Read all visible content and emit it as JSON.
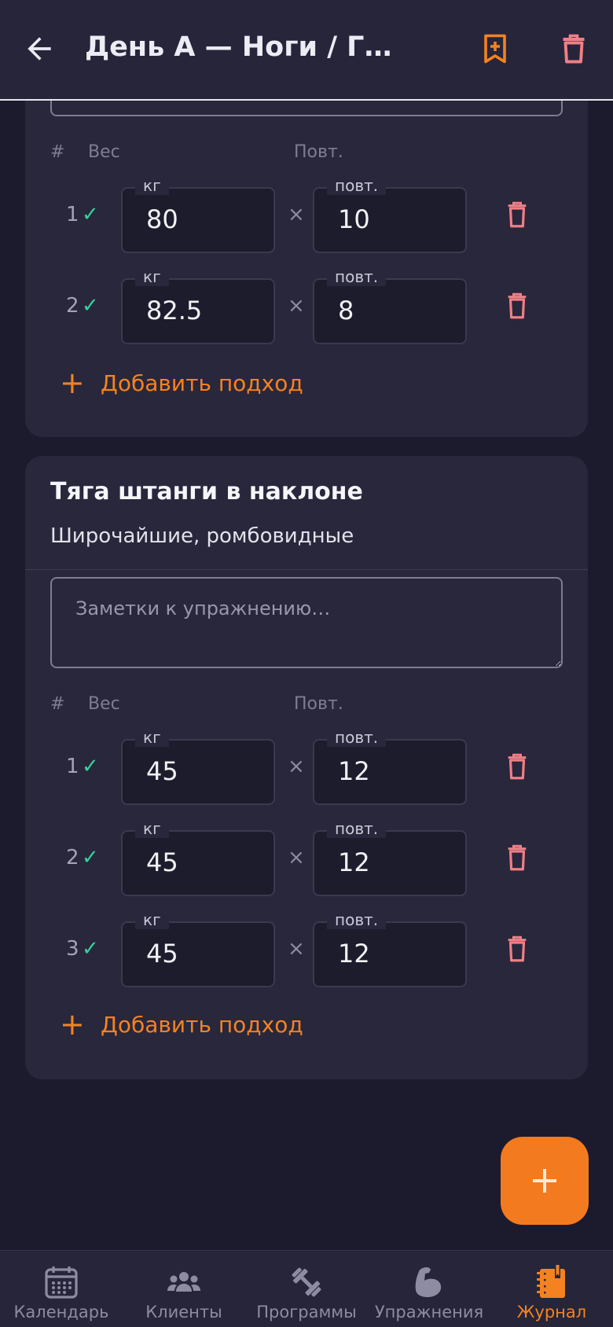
{
  "header": {
    "title": "День А — Ноги / Г…"
  },
  "labels": {
    "num_col": "#",
    "weight_col": "Вес",
    "reps_col": "Повт.",
    "kg": "кг",
    "reps": "повт.",
    "times": "×",
    "add_set": "Добавить подход",
    "plus": "+",
    "check": "✓"
  },
  "exercise1": {
    "sets": [
      {
        "num": "1",
        "weight": "80",
        "reps": "10"
      },
      {
        "num": "2",
        "weight": "82.5",
        "reps": "8"
      }
    ]
  },
  "exercise2": {
    "name": "Тяга штанги в наклоне",
    "muscles": "Широчайшие, ромбовидные",
    "notes_placeholder": "Заметки к упражнению…",
    "sets": [
      {
        "num": "1",
        "weight": "45",
        "reps": "12"
      },
      {
        "num": "2",
        "weight": "45",
        "reps": "12"
      },
      {
        "num": "3",
        "weight": "45",
        "reps": "12"
      }
    ]
  },
  "bottom_nav": {
    "items": [
      {
        "label": "Календарь",
        "icon": "calendar-icon"
      },
      {
        "label": "Клиенты",
        "icon": "group-icon"
      },
      {
        "label": "Программы",
        "icon": "dumbbell-icon"
      },
      {
        "label": "Упражнения",
        "icon": "bicep-icon"
      },
      {
        "label": "Журнал",
        "icon": "journal-icon"
      }
    ],
    "active_index": 4
  },
  "colors": {
    "accent": "#f58220",
    "danger": "#f07f86",
    "check": "#34d29b",
    "background": "#1c1b2e",
    "card": "#28273c"
  }
}
